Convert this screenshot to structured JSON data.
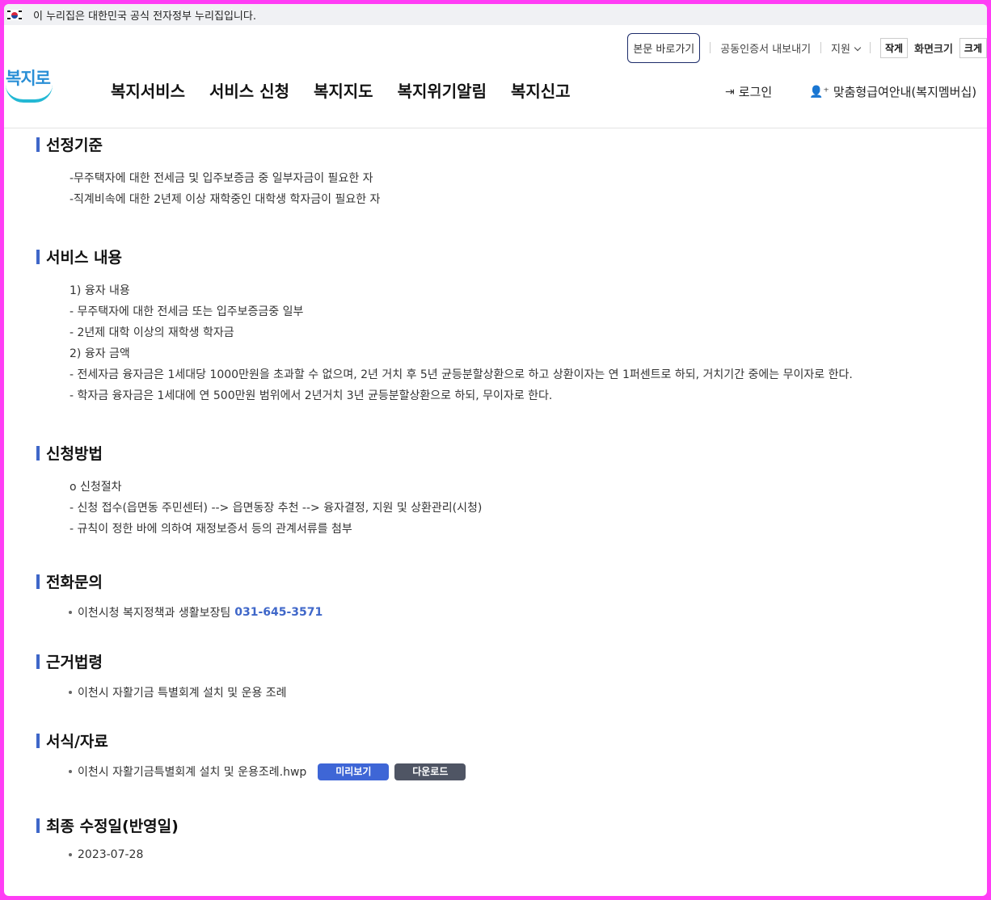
{
  "gov_banner": {
    "text": "이 누리집은 대한민국 공식 전자정부 누리집입니다."
  },
  "util": {
    "skip_label": "본문 바로가기",
    "cert_label": "공동인증서 내보내기",
    "support_label": "지원",
    "font_small": "작게",
    "font_label": "화면크기",
    "font_large": "크게"
  },
  "header": {
    "logo_text": "복지로",
    "nav": [
      "복지서비스",
      "서비스 신청",
      "복지지도",
      "복지위기알림",
      "복지신고"
    ],
    "login_label": "로그인",
    "member_label": "맞춤형급여안내(복지멤버십)"
  },
  "sections": {
    "criteria": {
      "title": "선정기준",
      "lines": [
        "-무주택자에 대한 전세금 및 입주보증금 중 일부자금이 필요한 자",
        "-직계비속에 대한 2년제 이상 재학중인 대학생 학자금이 필요한 자"
      ]
    },
    "content": {
      "title": "서비스 내용",
      "lines": [
        "1) 융자 내용",
        "- 무주택자에 대한 전세금 또는 입주보증금중 일부",
        "- 2년제 대학 이상의 재학생 학자금",
        "2) 융자 금액",
        "- 전세자금 융자금은 1세대당 1000만원을 초과할 수 없으며, 2년 거치 후 5년 균등분할상환으로 하고 상환이자는 연 1퍼센트로 하되, 거치기간 중에는 무이자로 한다.",
        "- 학자금 융자금은 1세대에 연 500만원 범위에서 2년거치 3년 균등분할상환으로 하되, 무이자로 한다."
      ]
    },
    "apply": {
      "title": "신청방법",
      "lines": [
        "o 신청절차",
        "- 신청 접수(읍면동 주민센터) --> 읍면동장 추천 --> 융자결정, 지원 및 상환관리(시청)",
        "- 규칙이 정한 바에 의하여 재정보증서 등의 관계서류를 첨부"
      ]
    },
    "phone": {
      "title": "전화문의",
      "org": "이천시청 복지정책과 생활보장팀",
      "number": "031-645-3571"
    },
    "law": {
      "title": "근거법령",
      "item": "이천시 자활기금 특별회계 설치 및 운용 조례"
    },
    "forms": {
      "title": "서식/자료",
      "file": "이천시 자활기금특별회계 설치 및 운용조례.hwp",
      "preview_label": "미리보기",
      "download_label": "다운로드"
    },
    "updated": {
      "title": "최종 수정일(반영일)",
      "date": "2023-07-28"
    }
  },
  "colors": {
    "accent": "#3f67c9",
    "preview_button": "#3e66d6",
    "download_button": "#4f5564"
  }
}
